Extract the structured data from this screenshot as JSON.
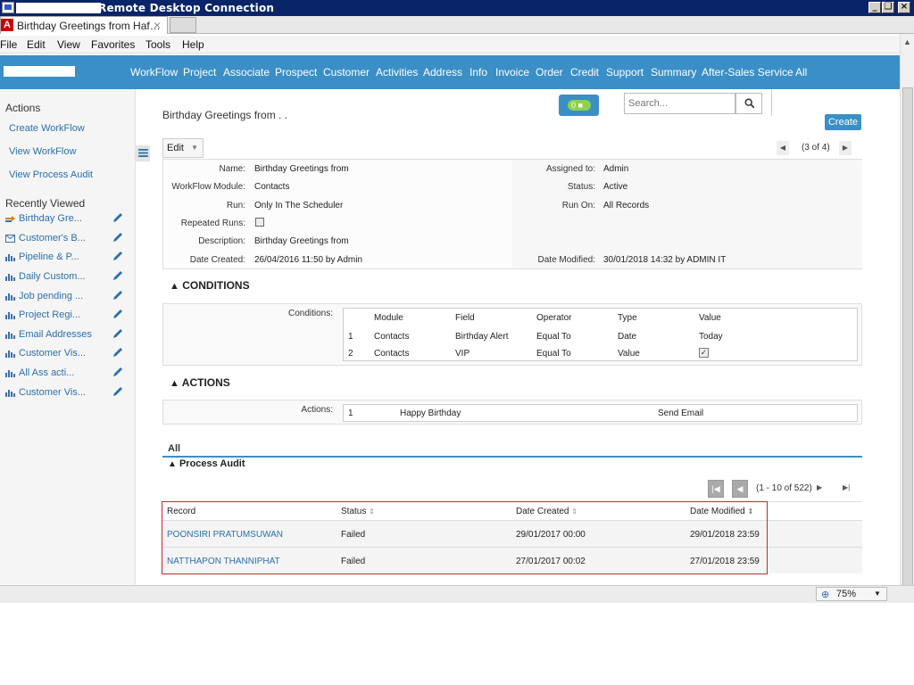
{
  "window": {
    "title": "Remote Desktop Connection"
  },
  "browser": {
    "tab_title": "Birthday Greetings from Haf…",
    "menu": [
      "File",
      "Edit",
      "View",
      "Favorites",
      "Tools",
      "Help"
    ],
    "zoom": "75%"
  },
  "nav": {
    "links": [
      "WorkFlow",
      "Project",
      "Associate",
      "Prospect",
      "Customer",
      "Activities",
      "Address",
      "Info",
      "Invoice",
      "Order",
      "Credit",
      "Support",
      "Summary",
      "After-Sales Service",
      "All"
    ]
  },
  "sidebar": {
    "actions_heading": "Actions",
    "actions": [
      "Create WorkFlow",
      "View WorkFlow",
      "View Process Audit"
    ],
    "recent_heading": "Recently Viewed",
    "recent": [
      "Birthday Gre...",
      "Customer's B...",
      "Pipeline & P...",
      "Daily Custom...",
      "Job pending ...",
      "Project Regi...",
      "Email Addresses",
      "Customer Vis...",
      "All Ass acti...",
      "Customer Vis..."
    ]
  },
  "header": {
    "title": "Birthday Greetings from . .",
    "notifications": "0",
    "search_placeholder": "Search...",
    "create": "Create",
    "edit": "Edit",
    "pagination": "(3 of 4)"
  },
  "detail": {
    "name_label": "Name:",
    "name": "Birthday Greetings from",
    "module_label": "WorkFlow Module:",
    "module": "Contacts",
    "run_label": "Run:",
    "run": "Only In The Scheduler",
    "repeated_label": "Repeated Runs:",
    "repeated": false,
    "description_label": "Description:",
    "description": "Birthday Greetings from",
    "created_label": "Date Created:",
    "created": "26/04/2016 11:50 by Admin",
    "assigned_label": "Assigned to:",
    "assigned": "Admin",
    "status_label": "Status:",
    "status": "Active",
    "runon_label": "Run On:",
    "runon": "All Records",
    "modified_label": "Date Modified:",
    "modified": "30/01/2018 14:32 by ADMIN IT"
  },
  "conditions": {
    "heading": "CONDITIONS",
    "label": "Conditions:",
    "columns": [
      "Module",
      "Field",
      "Operator",
      "Type",
      "Value"
    ],
    "rows": [
      {
        "n": "1",
        "module": "Contacts",
        "field": "Birthday Alert",
        "operator": "Equal To",
        "type": "Date",
        "value": "Today"
      },
      {
        "n": "2",
        "module": "Contacts",
        "field": "VIP",
        "operator": "Equal To",
        "type": "Value",
        "value": "checked"
      }
    ]
  },
  "actions": {
    "heading": "ACTIONS",
    "label": "Actions:",
    "rows": [
      {
        "n": "1",
        "name": "Happy Birthday",
        "type": "Send Email"
      }
    ]
  },
  "audit": {
    "tab": "All",
    "heading": "Process Audit",
    "pager": "(1 - 10 of 522)",
    "columns": [
      "Record",
      "Status",
      "Date Created",
      "Date Modified"
    ],
    "rows": [
      {
        "record": "POONSIRI PRATUMSUWAN",
        "status": "Failed",
        "created": "29/01/2017 00:00",
        "modified": "29/01/2018 23:59"
      },
      {
        "record": "NATTHAPON THANNIPHAT",
        "status": "Failed",
        "created": "27/01/2017 00:02",
        "modified": "27/01/2018 23:59"
      }
    ]
  }
}
